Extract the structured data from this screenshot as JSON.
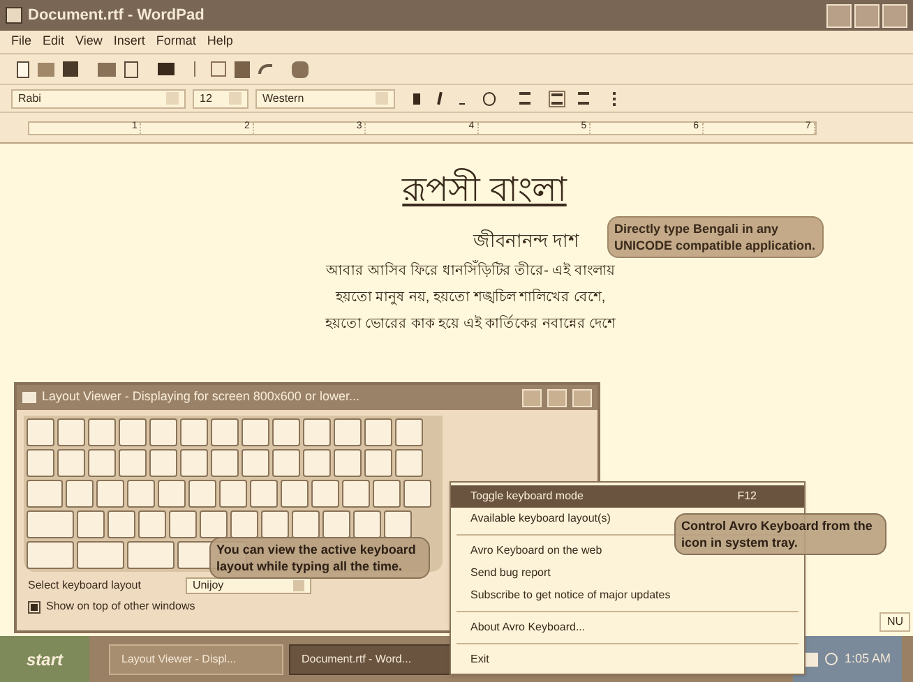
{
  "window": {
    "title": "Document.rtf - WordPad"
  },
  "menu": [
    "File",
    "Edit",
    "View",
    "Insert",
    "Format",
    "Help"
  ],
  "format_bar": {
    "font": "Rabi",
    "size": "12",
    "script": "Western"
  },
  "ruler": [
    "1",
    "2",
    "3",
    "4",
    "5",
    "6",
    "7"
  ],
  "document": {
    "title": "রূপসী বাংলা",
    "author": "জীবনানন্দ দাশ",
    "lines": [
      "আবার আসিব ফিরে ধানসিঁড়িটির তীরে- এই বাংলায়",
      "হয়তো মানুষ নয়, হয়তো শঙ্খচিল শালিখের বেশে,",
      "হয়তো ভোরের কাক হয়ে এই কার্তিকের নবান্নের দেশে"
    ]
  },
  "callouts": [
    "Directly type Bengali in any UNICODE compatible application.",
    "You can view the active keyboard layout while typing all the time.",
    "Control Avro Keyboard from the icon in system tray."
  ],
  "layout_viewer": {
    "title": "Layout Viewer - Displaying for screen 800x600 or lower...",
    "select_label": "Select keyboard layout",
    "layout": "Unijoy",
    "show_on_top": {
      "label": "Show on top of other windows",
      "checked": true
    }
  },
  "tray_menu": [
    {
      "label": "Toggle keyboard mode",
      "shortcut": "F12",
      "selected": true
    },
    {
      "label": "Available keyboard layout(s)",
      "selected": false,
      "separator_after": true
    },
    {
      "label": "Avro Keyboard on the web",
      "selected": false
    },
    {
      "label": "Send bug report",
      "selected": false
    },
    {
      "label": "Subscribe to get notice of major updates",
      "selected": false,
      "separator_after": true
    },
    {
      "label": "About Avro Keyboard...",
      "selected": false,
      "separator_after": true
    },
    {
      "label": "Exit",
      "selected": false
    }
  ],
  "status_bar": {
    "indicator": "NU"
  },
  "taskbar": {
    "start": "start",
    "tasks": [
      {
        "label": "Layout Viewer - Displ...",
        "selected": false
      },
      {
        "label": "Document.rtf - Word...",
        "selected": true
      }
    ],
    "clock": "1:05 AM"
  }
}
